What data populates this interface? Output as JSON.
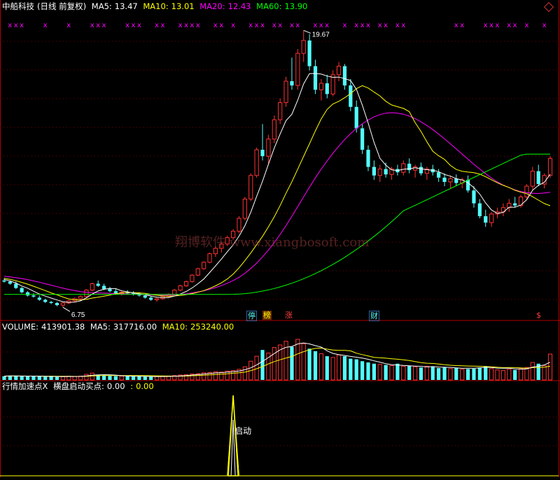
{
  "header": {
    "stock_name": "中船科技",
    "period_label": "(日线 前复权)",
    "ma5_label": "MA5:",
    "ma5_value": "13.47",
    "ma10_label": "MA10:",
    "ma10_value": "13.01",
    "ma20_label": "MA20:",
    "ma20_value": "12.43",
    "ma60_label": "MA60:",
    "ma60_value": "13.90"
  },
  "volume_header": {
    "label": "VOLUME:",
    "value": "413901.38",
    "ma5_label": "MA5:",
    "ma5_value": "317716.00",
    "ma10_label": "MA10:",
    "ma10_value": "253240.00"
  },
  "indicator_header": {
    "title": "行情加速点X",
    "name": "横盘启动买点:",
    "value1": "0.00",
    "sep": ":",
    "value2": "0.00"
  },
  "watermark": "翔博软件 www.xiangbosoft.com",
  "high_marker": "19.67",
  "low_marker": "6.75",
  "event_tags": [
    "停",
    "榜",
    "涨",
    "财",
    "$"
  ],
  "signal_label": "启动",
  "signal_mark": "x",
  "colors": {
    "up": "#ff3232",
    "down": "#54fcfc",
    "ma5": "#ffffff",
    "ma10": "#ffff00",
    "ma20": "#ff00ff",
    "ma60": "#00ff00",
    "grid": "#7a0000",
    "signal": "#ff00ff"
  },
  "chart_data": [
    {
      "type": "candlestick",
      "title": "中船科技 (日线 前复权)",
      "ylim": [
        6.2,
        20.5
      ],
      "high_value": 19.67,
      "low_value": 6.75,
      "candles": [
        [
          8.0,
          8.1,
          7.9,
          7.95
        ],
        [
          7.95,
          8.0,
          7.8,
          7.85
        ],
        [
          7.85,
          7.95,
          7.6,
          7.65
        ],
        [
          7.65,
          7.7,
          7.4,
          7.45
        ],
        [
          7.45,
          7.5,
          7.25,
          7.3
        ],
        [
          7.3,
          7.4,
          7.2,
          7.25
        ],
        [
          7.2,
          7.3,
          7.05,
          7.1
        ],
        [
          7.1,
          7.15,
          6.95,
          7.0
        ],
        [
          7.0,
          7.05,
          6.9,
          6.95
        ],
        [
          6.95,
          7.0,
          6.8,
          6.85
        ],
        [
          6.85,
          7.0,
          6.75,
          6.95
        ],
        [
          6.95,
          7.1,
          6.9,
          7.05
        ],
        [
          7.05,
          7.2,
          7.0,
          7.15
        ],
        [
          7.15,
          7.3,
          7.1,
          7.25
        ],
        [
          7.25,
          7.6,
          7.2,
          7.55
        ],
        [
          7.55,
          7.9,
          7.5,
          7.85
        ],
        [
          7.85,
          8.0,
          7.7,
          7.75
        ],
        [
          7.75,
          7.85,
          7.55,
          7.6
        ],
        [
          7.6,
          7.7,
          7.45,
          7.5
        ],
        [
          7.5,
          7.6,
          7.35,
          7.4
        ],
        [
          7.4,
          7.5,
          7.3,
          7.45
        ],
        [
          7.45,
          7.55,
          7.35,
          7.4
        ],
        [
          7.4,
          7.5,
          7.3,
          7.35
        ],
        [
          7.35,
          7.45,
          7.25,
          7.3
        ],
        [
          7.3,
          7.35,
          7.15,
          7.2
        ],
        [
          7.2,
          7.25,
          7.05,
          7.1
        ],
        [
          7.1,
          7.2,
          7.0,
          7.15
        ],
        [
          7.15,
          7.3,
          7.1,
          7.25
        ],
        [
          7.25,
          7.4,
          7.2,
          7.35
        ],
        [
          7.35,
          7.6,
          7.3,
          7.55
        ],
        [
          7.55,
          7.8,
          7.5,
          7.75
        ],
        [
          7.75,
          8.0,
          7.7,
          7.95
        ],
        [
          7.95,
          8.3,
          7.9,
          8.25
        ],
        [
          8.25,
          8.6,
          8.2,
          8.55
        ],
        [
          8.55,
          8.9,
          8.5,
          8.85
        ],
        [
          8.85,
          9.3,
          8.8,
          9.25
        ],
        [
          9.25,
          9.6,
          9.1,
          9.5
        ],
        [
          9.5,
          9.8,
          9.3,
          9.7
        ],
        [
          9.7,
          10.1,
          9.6,
          10.0
        ],
        [
          10.0,
          10.4,
          9.9,
          10.3
        ],
        [
          10.3,
          11.0,
          10.2,
          10.9
        ],
        [
          10.9,
          11.9,
          10.8,
          11.8
        ],
        [
          11.8,
          13.0,
          11.7,
          12.9
        ],
        [
          12.9,
          14.2,
          12.8,
          14.1
        ],
        [
          14.1,
          15.3,
          13.6,
          13.8
        ],
        [
          13.8,
          14.8,
          13.4,
          14.6
        ],
        [
          14.6,
          15.7,
          14.4,
          15.5
        ],
        [
          15.5,
          16.5,
          15.3,
          16.3
        ],
        [
          16.3,
          17.5,
          16.1,
          17.3
        ],
        [
          17.3,
          18.4,
          16.9,
          17.1
        ],
        [
          17.1,
          18.8,
          16.9,
          18.6
        ],
        [
          18.6,
          19.67,
          18.2,
          19.2
        ],
        [
          19.2,
          19.5,
          17.8,
          18.0
        ],
        [
          18.0,
          18.3,
          16.7,
          16.9
        ],
        [
          16.9,
          17.4,
          16.4,
          17.2
        ],
        [
          17.2,
          17.6,
          16.5,
          16.7
        ],
        [
          16.7,
          17.8,
          16.6,
          17.6
        ],
        [
          17.6,
          18.2,
          17.3,
          18.0
        ],
        [
          18.0,
          18.1,
          16.9,
          17.1
        ],
        [
          17.1,
          17.4,
          15.9,
          16.1
        ],
        [
          16.1,
          16.4,
          14.9,
          15.1
        ],
        [
          15.1,
          15.3,
          13.9,
          14.1
        ],
        [
          14.1,
          14.3,
          13.1,
          13.3
        ],
        [
          13.3,
          13.6,
          12.7,
          12.9
        ],
        [
          12.9,
          13.4,
          12.6,
          13.2
        ],
        [
          13.2,
          13.5,
          12.8,
          12.95
        ],
        [
          12.95,
          13.3,
          12.7,
          13.2
        ],
        [
          13.2,
          13.4,
          12.9,
          13.05
        ],
        [
          13.05,
          13.6,
          12.9,
          13.45
        ],
        [
          13.45,
          13.7,
          13.0,
          13.15
        ],
        [
          13.15,
          13.4,
          12.8,
          13.3
        ],
        [
          13.3,
          13.5,
          12.9,
          13.0
        ],
        [
          13.0,
          13.3,
          12.7,
          13.2
        ],
        [
          13.2,
          13.4,
          12.9,
          13.05
        ],
        [
          13.05,
          13.2,
          12.6,
          12.8
        ],
        [
          12.8,
          13.0,
          12.4,
          12.6
        ],
        [
          12.6,
          12.9,
          12.3,
          12.75
        ],
        [
          12.75,
          12.95,
          12.4,
          12.55
        ],
        [
          12.55,
          12.8,
          12.3,
          12.7
        ],
        [
          12.7,
          12.9,
          12.1,
          12.2
        ],
        [
          12.2,
          12.4,
          11.4,
          11.6
        ],
        [
          11.6,
          11.8,
          10.9,
          11.0
        ],
        [
          11.0,
          11.3,
          10.5,
          10.7
        ],
        [
          10.7,
          11.2,
          10.5,
          11.1
        ],
        [
          11.1,
          11.4,
          10.9,
          11.2
        ],
        [
          11.2,
          11.6,
          11.0,
          11.4
        ],
        [
          11.4,
          11.8,
          11.2,
          11.6
        ],
        [
          11.6,
          11.9,
          11.4,
          11.5
        ],
        [
          11.5,
          12.0,
          11.4,
          11.9
        ],
        [
          11.9,
          12.5,
          11.8,
          12.4
        ],
        [
          12.4,
          13.3,
          12.2,
          13.1
        ],
        [
          13.1,
          13.4,
          12.4,
          12.5
        ],
        [
          12.5,
          13.0,
          12.3,
          12.9
        ],
        [
          12.9,
          13.8,
          12.8,
          13.7
        ]
      ],
      "ma5": [
        8.05,
        7.98,
        7.88,
        7.74,
        7.64,
        7.5,
        7.37,
        7.27,
        7.18,
        7.09,
        7.01,
        6.98,
        6.99,
        7.05,
        7.19,
        7.37,
        7.51,
        7.59,
        7.63,
        7.62,
        7.52,
        7.47,
        7.42,
        7.38,
        7.34,
        7.27,
        7.22,
        7.2,
        7.2,
        7.27,
        7.37,
        7.49,
        7.65,
        7.85,
        8.07,
        8.37,
        8.68,
        9.0,
        9.34,
        9.66,
        10.07,
        10.56,
        11.19,
        11.92,
        12.63,
        13.42,
        14.18,
        14.84,
        15.46,
        15.76,
        16.42,
        17.17,
        17.65,
        17.66,
        17.63,
        17.54,
        17.48,
        17.49,
        17.42,
        17.33,
        16.92,
        16.18,
        15.34,
        14.44,
        13.7,
        13.38,
        13.16,
        13.13,
        13.19,
        13.21,
        13.26,
        13.21,
        13.17,
        13.14,
        13.08,
        12.95,
        12.87,
        12.75,
        12.69,
        12.56,
        12.33,
        12.03,
        11.62,
        11.29,
        11.13,
        11.18,
        11.42,
        11.42,
        11.52,
        11.77,
        12.21,
        12.44,
        12.58,
        12.96
      ],
      "ma10": [
        8.1,
        8.05,
        7.99,
        7.91,
        7.83,
        7.73,
        7.63,
        7.53,
        7.42,
        7.33,
        7.23,
        7.14,
        7.1,
        7.09,
        7.12,
        7.18,
        7.22,
        7.27,
        7.32,
        7.38,
        7.42,
        7.44,
        7.43,
        7.42,
        7.4,
        7.35,
        7.31,
        7.28,
        7.27,
        7.28,
        7.3,
        7.34,
        7.39,
        7.45,
        7.53,
        7.63,
        7.75,
        7.89,
        8.07,
        8.3,
        8.59,
        8.93,
        9.29,
        9.67,
        10.06,
        10.5,
        10.97,
        11.5,
        12.07,
        12.61,
        13.2,
        13.79,
        14.38,
        14.98,
        15.54,
        15.98,
        16.24,
        16.36,
        16.53,
        16.72,
        16.95,
        17.09,
        16.98,
        16.79,
        16.61,
        16.36,
        16.19,
        16.11,
        16.03,
        15.88,
        15.36,
        14.95,
        14.47,
        14.03,
        13.82,
        13.65,
        13.37,
        13.18,
        13.1,
        13.06,
        13.03,
        12.96,
        12.84,
        12.7,
        12.56,
        12.44,
        12.34,
        12.21,
        12.12,
        12.05,
        11.91,
        11.75,
        11.59,
        11.49
      ],
      "ma20": [
        8.2,
        8.17,
        8.13,
        8.09,
        8.04,
        7.98,
        7.92,
        7.85,
        7.78,
        7.71,
        7.64,
        7.58,
        7.53,
        7.48,
        7.45,
        7.43,
        7.42,
        7.41,
        7.4,
        7.39,
        7.38,
        7.37,
        7.36,
        7.35,
        7.34,
        7.33,
        7.32,
        7.32,
        7.32,
        7.33,
        7.35,
        7.38,
        7.42,
        7.47,
        7.52,
        7.59,
        7.67,
        7.76,
        7.87,
        8.0,
        8.15,
        8.34,
        8.56,
        8.81,
        9.1,
        9.42,
        9.77,
        10.15,
        10.56,
        11.0,
        11.45,
        11.9,
        12.35,
        12.79,
        13.2,
        13.58,
        13.94,
        14.27,
        14.58,
        14.85,
        15.1,
        15.31,
        15.49,
        15.64,
        15.74,
        15.81,
        15.83,
        15.81,
        15.76,
        15.67,
        15.55,
        15.4,
        15.23,
        15.04,
        14.83,
        14.61,
        14.38,
        14.14,
        13.9,
        13.66,
        13.42,
        13.2,
        12.98,
        12.78,
        12.6,
        12.45,
        12.33,
        12.23,
        12.15,
        12.1,
        12.07,
        12.06,
        12.08,
        12.12
      ]
    },
    {
      "type": "bar",
      "title": "VOLUME",
      "last_value": 413901.38,
      "ma5_last": 317716.0,
      "ma10_last": 253240.0,
      "ylim": [
        0,
        750000
      ],
      "values": [
        60,
        70,
        65,
        55,
        60,
        58,
        62,
        50,
        55,
        48,
        52,
        60,
        58,
        62,
        90,
        110,
        80,
        70,
        65,
        60,
        62,
        58,
        55,
        60,
        52,
        50,
        55,
        60,
        62,
        70,
        80,
        85,
        95,
        100,
        115,
        120,
        130,
        125,
        140,
        150,
        170,
        210,
        300,
        380,
        480,
        430,
        520,
        560,
        620,
        530,
        650,
        580,
        500,
        460,
        420,
        380,
        360,
        400,
        380,
        340,
        330,
        300,
        280,
        260,
        250,
        240,
        230,
        260,
        220,
        230,
        210,
        200,
        220,
        210,
        190,
        200,
        180,
        190,
        170,
        175,
        180,
        200,
        220,
        180,
        160,
        150,
        170,
        160,
        180,
        200,
        280,
        260,
        230,
        414
      ],
      "ma5": [
        62,
        64,
        64,
        62,
        62,
        62,
        60,
        57,
        56,
        55,
        53,
        55,
        55,
        56,
        64,
        76,
        82,
        84,
        83,
        77,
        67,
        63,
        60,
        59,
        57,
        55,
        54,
        55,
        56,
        60,
        65,
        71,
        78,
        86,
        95,
        104,
        112,
        118,
        124,
        133,
        143,
        163,
        194,
        240,
        296,
        358,
        422,
        482,
        522,
        536,
        576,
        592,
        576,
        548,
        526,
        466,
        424,
        404,
        392,
        376,
        364,
        350,
        330,
        306,
        284,
        260,
        244,
        240,
        232,
        226,
        222,
        218,
        208,
        214,
        206,
        204,
        200,
        194,
        186,
        187,
        187,
        193,
        203,
        198,
        189,
        188,
        188,
        178,
        174,
        177,
        206,
        220,
        239,
        284
      ],
      "ma10": [
        60,
        62,
        63,
        63,
        62,
        62,
        62,
        61,
        60,
        59,
        58,
        58,
        56,
        56,
        59,
        64,
        68,
        70,
        70,
        70,
        70,
        69,
        69,
        71,
        70,
        68,
        66,
        64,
        63,
        60,
        61,
        63,
        67,
        72,
        76,
        81,
        86,
        92,
        99,
        107,
        115,
        127,
        148,
        179,
        214,
        256,
        293,
        322,
        352,
        375,
        417,
        452,
        484,
        505,
        511,
        492,
        478,
        474,
        473,
        466,
        428,
        405,
        384,
        362,
        355,
        348,
        339,
        331,
        322,
        310,
        293,
        277,
        268,
        264,
        255,
        243,
        235,
        229,
        226,
        223,
        220,
        218,
        216,
        209,
        203,
        197,
        199,
        199,
        194,
        188,
        197,
        199,
        204,
        222
      ]
    },
    {
      "type": "line",
      "title": "行情加速点X",
      "series_name": "横盘启动买点",
      "ylim": [
        0,
        1
      ],
      "values": [
        0,
        0,
        0,
        0,
        0,
        0,
        0,
        0,
        0,
        0,
        0,
        0,
        0,
        0,
        0,
        0,
        0,
        0,
        0,
        0,
        0,
        0,
        0,
        0,
        0,
        0,
        0,
        0,
        0,
        0,
        0,
        0,
        0,
        0,
        0,
        0,
        0,
        0,
        0,
        1,
        0,
        0,
        0,
        0,
        0,
        0,
        0,
        0,
        0,
        0,
        0,
        0,
        0,
        0,
        0,
        0,
        0,
        0,
        0,
        0,
        0,
        0,
        0,
        0,
        0,
        0,
        0,
        0,
        0,
        0,
        0,
        0,
        0,
        0,
        0,
        0,
        0,
        0,
        0,
        0,
        0,
        0,
        0,
        0,
        0,
        0,
        0,
        0,
        0,
        0,
        0,
        0,
        0,
        0
      ]
    }
  ]
}
